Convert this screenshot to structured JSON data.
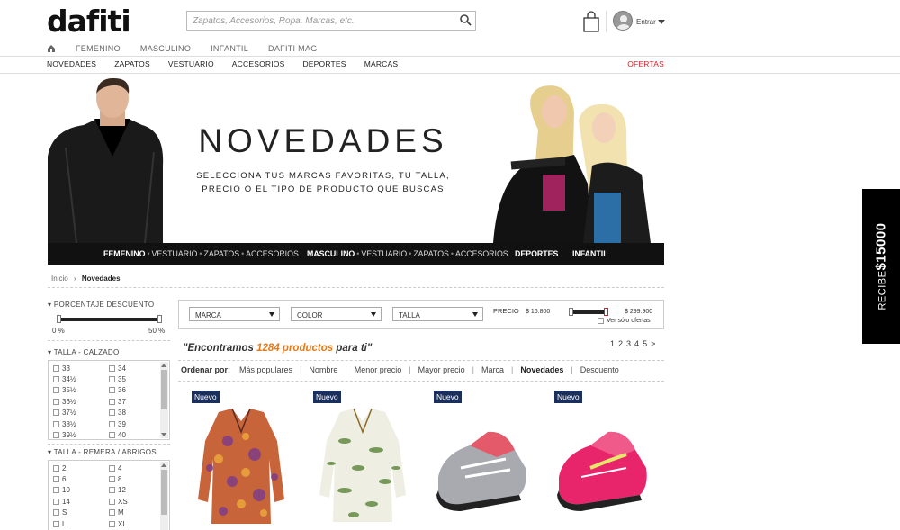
{
  "header": {
    "logo": "dafiti",
    "search_placeholder": "Zapatos, Accesorios, Ropa, Marcas, etc.",
    "login_label": "Entrar"
  },
  "nav_primary": [
    "FEMENINO",
    "MASCULINO",
    "INFANTIL",
    "DAFITI MAG"
  ],
  "nav_secondary": [
    "NOVEDADES",
    "ZAPATOS",
    "VESTUARIO",
    "ACCESORIOS",
    "DEPORTES",
    "MARCAS"
  ],
  "nav_ofertas": "OFERTAS",
  "banner": {
    "title": "NOVEDADES",
    "subtitle_line1": "SELECCIONA TUS MARCAS FAVORITAS, TU TALLA,",
    "subtitle_line2": "PRECIO O EL TIPO DE PRODUCTO QUE BUSCAS",
    "bar": {
      "femenino": "FEMENINO",
      "femenino_links": [
        "VESTUARIO",
        "ZAPATOS",
        "ACCESORIOS"
      ],
      "masculino": "MASCULINO",
      "masculino_links": [
        "VESTUARIO",
        "ZAPATOS",
        "ACCESORIOS"
      ],
      "deportes": "DEPORTES",
      "infantil": "INFANTIL"
    }
  },
  "promo": {
    "prefix": "RECIBE",
    "amount": "$15000"
  },
  "breadcrumb": {
    "home": "Inicio",
    "sep": "›",
    "current": "Novedades"
  },
  "filters": {
    "discount": {
      "title": "PORCENTAJE DESCUENTO",
      "min": "0 %",
      "max": "50 %"
    },
    "shoe_size": {
      "title": "TALLA - CALZADO",
      "options": [
        "33",
        "34",
        "34½",
        "35",
        "35½",
        "36",
        "36½",
        "37",
        "37½",
        "38",
        "38½",
        "39",
        "39½",
        "40"
      ]
    },
    "shirt_size": {
      "title": "TALLA - REMERA / ABRIGOS",
      "options": [
        "2",
        "4",
        "6",
        "8",
        "10",
        "12",
        "14",
        "XS",
        "S",
        "M",
        "L",
        "XL"
      ]
    }
  },
  "filter_bar": {
    "brand": "MARCA",
    "color": "COLOR",
    "size": "TALLA",
    "price_label": "PRECIO",
    "price_min": "$ 16.800",
    "price_max": "$ 299.900",
    "offers_only": "Ver sólo ofertas"
  },
  "results": {
    "prefix": "\"Encontramos ",
    "count": "1284 productos",
    "suffix": " para ti\"",
    "pages": [
      "1",
      "2",
      "3",
      "4",
      "5",
      ">"
    ]
  },
  "sort": {
    "label": "Ordenar por:",
    "options": [
      "Más populares",
      "Nombre",
      "Menor precio",
      "Mayor precio",
      "Marca",
      "Novedades",
      "Descuento"
    ],
    "active_index": 5
  },
  "products": [
    {
      "badge": "Nuevo"
    },
    {
      "badge": "Nuevo"
    },
    {
      "badge": "Nuevo"
    },
    {
      "badge": "Nuevo"
    }
  ],
  "colors": {
    "accent": "#e07a1b",
    "ofertas": "#d0232a",
    "badge": "#1b2f5c"
  }
}
